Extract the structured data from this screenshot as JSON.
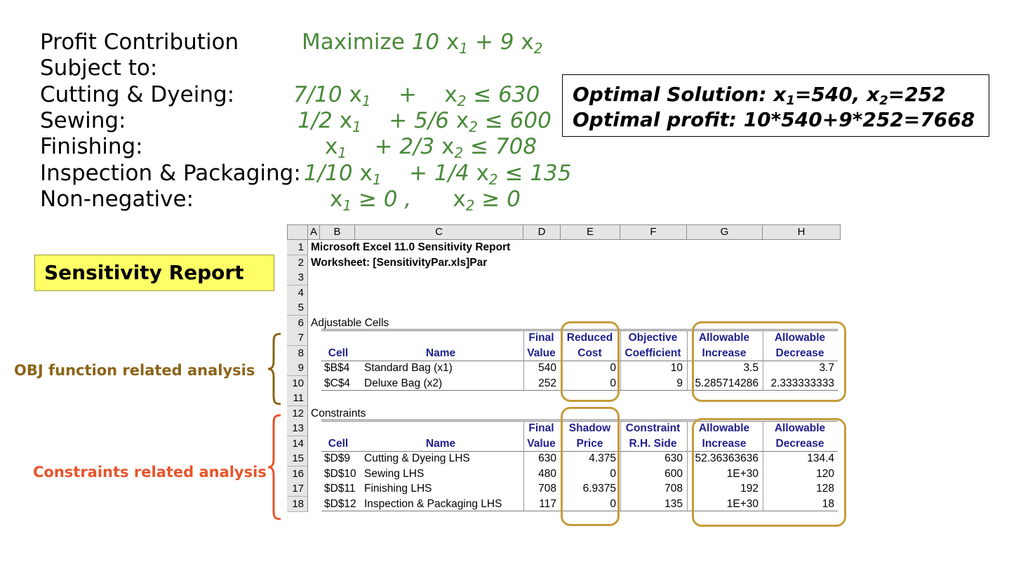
{
  "model": {
    "rows": [
      {
        "label": "Profit Contribution",
        "expr": "Maximize 10 x1 + 9 x2"
      },
      {
        "label": "Subject to:",
        "expr": ""
      },
      {
        "label": "Cutting & Dyeing:",
        "expr": "7/10 x1  +  x2 ≤ 630"
      },
      {
        "label": "Sewing:",
        "expr": "1/2 x1  + 5/6 x2 ≤ 600"
      },
      {
        "label": "Finishing:",
        "expr": "x1  + 2/3 x2 ≤ 708"
      },
      {
        "label": "Inspection & Packaging:",
        "expr": "1/10 x1  + 1/4 x2 ≤ 135"
      },
      {
        "label": "Non-negative:",
        "expr": "x1 ≥ 0 ,   x2 ≥ 0"
      }
    ]
  },
  "solution": {
    "line1": "Optimal Solution: x1=540, x2=252",
    "line2": "Optimal profit: 10*540+9*252=7668"
  },
  "report_label": "Sensitivity Report",
  "notes": {
    "objective": "OBJ function related analysis",
    "constraints": "Constraints related analysis"
  },
  "sheet": {
    "columns": [
      "A",
      "B",
      "C",
      "D",
      "E",
      "F",
      "G",
      "H"
    ],
    "row_numbers": [
      "1",
      "2",
      "3",
      "4",
      "5",
      "6",
      "7",
      "8",
      "9",
      "10",
      "11",
      "12",
      "13",
      "14",
      "15",
      "16",
      "17",
      "18"
    ],
    "title": "Microsoft Excel 11.0 Sensitivity Report",
    "worksheet": "Worksheet: [SensitivityPar.xls]Par",
    "adjustable": {
      "heading": "Adjustable Cells",
      "header_top": [
        "",
        "",
        "Final",
        "Reduced",
        "Objective",
        "Allowable",
        "Allowable"
      ],
      "header_bottom": [
        "Cell",
        "Name",
        "Value",
        "Cost",
        "Coefficient",
        "Increase",
        "Decrease"
      ],
      "rows": [
        [
          "$B$4",
          "Standard Bag (x1)",
          "540",
          "0",
          "10",
          "3.5",
          "3.7"
        ],
        [
          "$C$4",
          "Deluxe Bag (x2)",
          "252",
          "0",
          "9",
          "5.285714286",
          "2.333333333"
        ]
      ]
    },
    "constraints": {
      "heading": "Constraints",
      "header_top": [
        "",
        "",
        "Final",
        "Shadow",
        "Constraint",
        "Allowable",
        "Allowable"
      ],
      "header_bottom": [
        "Cell",
        "Name",
        "Value",
        "Price",
        "R.H. Side",
        "Increase",
        "Decrease"
      ],
      "rows": [
        [
          "$D$9",
          "Cutting & Dyeing LHS",
          "630",
          "4.375",
          "630",
          "52.36363636",
          "134.4"
        ],
        [
          "$D$10",
          "Sewing LHS",
          "480",
          "0",
          "600",
          "1E+30",
          "120"
        ],
        [
          "$D$11",
          "Finishing LHS",
          "708",
          "6.9375",
          "708",
          "192",
          "128"
        ],
        [
          "$D$12",
          "Inspection & Packaging LHS",
          "117",
          "0",
          "135",
          "1E+30",
          "18"
        ]
      ]
    }
  },
  "colors": {
    "model_green": "#4a8a3a",
    "highlight": "#c59c3c",
    "obj_note": "#8b6418",
    "con_note": "#e8542b",
    "report_yellow": "#ffff66",
    "header_blue": "#1f1f8f"
  }
}
